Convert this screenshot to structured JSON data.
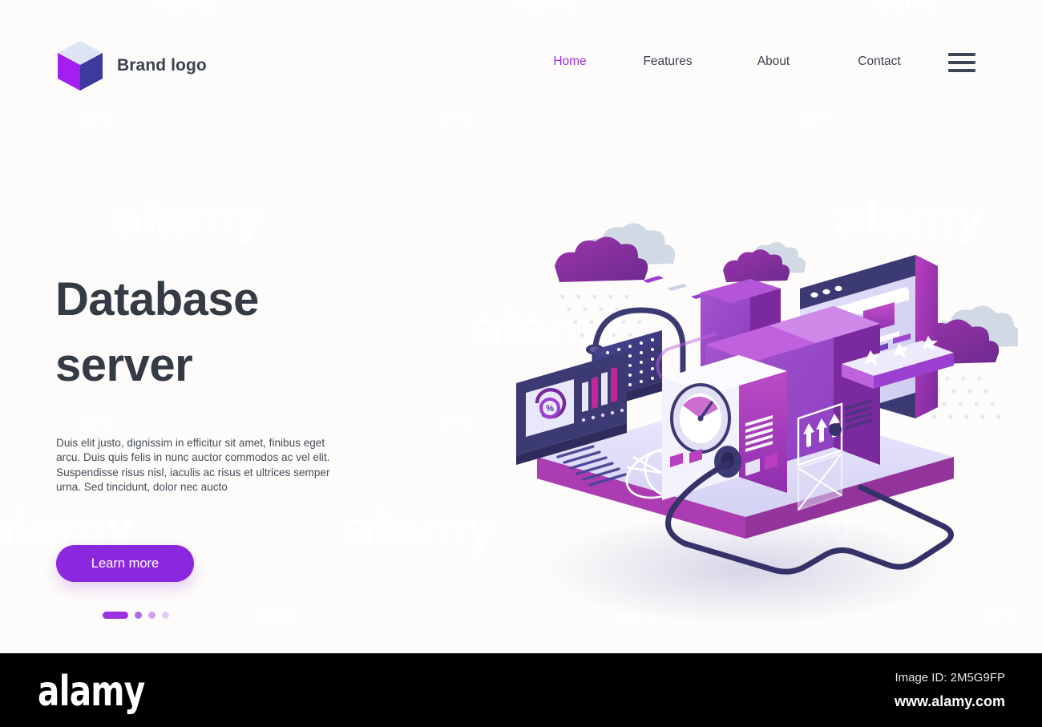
{
  "theme": {
    "background": "#fdfcfa",
    "accent_purple": "#9b30e0",
    "button_purple": "#8c27e0",
    "heading_color": "#343b45",
    "nav_color": "#3b4250",
    "platform_top": "#d9d8f6",
    "platform_edge": "#ab3cb2",
    "deep_indigo": "#3b3a73",
    "magenta": "#a32fa8"
  },
  "header": {
    "brand_name": "Brand logo",
    "logo_icon": "isometric-cube-icon",
    "menu_icon": "hamburger-menu-icon",
    "nav": [
      {
        "label": "Home",
        "active": true
      },
      {
        "label": "Features",
        "active": false
      },
      {
        "label": "About",
        "active": false
      },
      {
        "label": "Contact",
        "active": false
      }
    ]
  },
  "hero": {
    "title_line1": "Database",
    "title_line2": "server",
    "body": "Duis elit justo, dignissim in efficitur sit amet, finibus eget arcu. Duis quis felis in nunc auctor commodos ac vel elit. Suspendisse risus nisl, iaculis ac risus et ultrices semper urna. Sed tincidunt, dolor nec aucto",
    "cta_label": "Learn more",
    "carousel": {
      "total": 4,
      "active_index": 1
    }
  },
  "illustration": {
    "name": "isometric-database-server-illustration",
    "elements": [
      "platform-slab",
      "server-rack-main",
      "server-unit-front",
      "gauge-dial",
      "browser-window-panel",
      "analytics-card",
      "percent-badge",
      "bar-chart",
      "globe-grid",
      "star-rating-bar",
      "upload-arrows-card",
      "envelope-card",
      "rain-cloud-left",
      "rain-cloud-mid",
      "rain-cloud-right",
      "cable-navy",
      "lamp-arm",
      "perforated-panel"
    ],
    "star_count": 3,
    "arrow_count": 3,
    "browser_dots": 3
  },
  "watermark": {
    "text": "alamy",
    "footer_logo": "alamy",
    "image_id": "Image ID: 2M5G9FP",
    "url": "www.alamy.com"
  }
}
